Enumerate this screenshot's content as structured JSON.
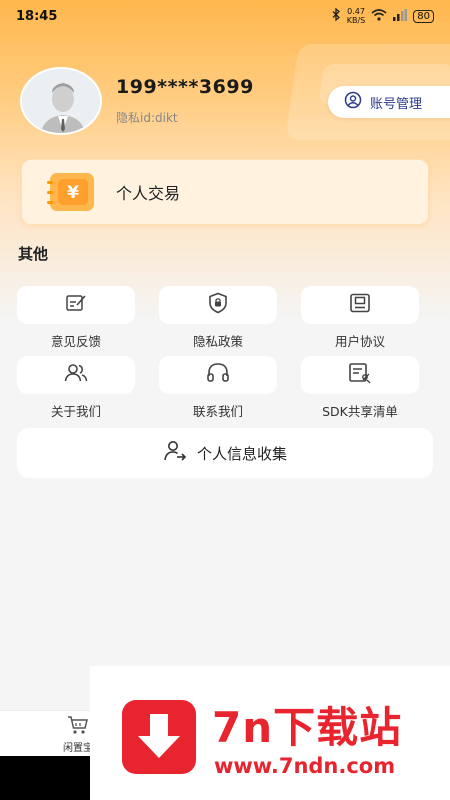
{
  "status_bar": {
    "time": "18:45",
    "net_speed_value": "0.47",
    "net_speed_unit": "KB/S",
    "battery": "80"
  },
  "profile": {
    "phone": "199****3699",
    "privacy_id": "隐私id:dikt",
    "account_button": "账号管理"
  },
  "trade": {
    "label": "个人交易",
    "icon_symbol": "¥"
  },
  "others": {
    "title": "其他",
    "items": [
      {
        "label": "意见反馈",
        "icon": "feedback-icon"
      },
      {
        "label": "隐私政策",
        "icon": "privacy-shield-icon"
      },
      {
        "label": "用户协议",
        "icon": "agreement-icon"
      },
      {
        "label": "关于我们",
        "icon": "people-icon"
      },
      {
        "label": "联系我们",
        "icon": "headset-icon"
      },
      {
        "label": "SDK共享清单",
        "icon": "sdk-list-icon"
      }
    ],
    "collect_button": "个人信息收集"
  },
  "bottom_nav": {
    "item_label": "闲置宝"
  },
  "watermark": {
    "title": "7n下载站",
    "url": "www.7ndn.com"
  },
  "colors": {
    "accent": "#ff9f2e",
    "account_text": "#2b3a8c",
    "watermark_red": "#e8242f"
  }
}
